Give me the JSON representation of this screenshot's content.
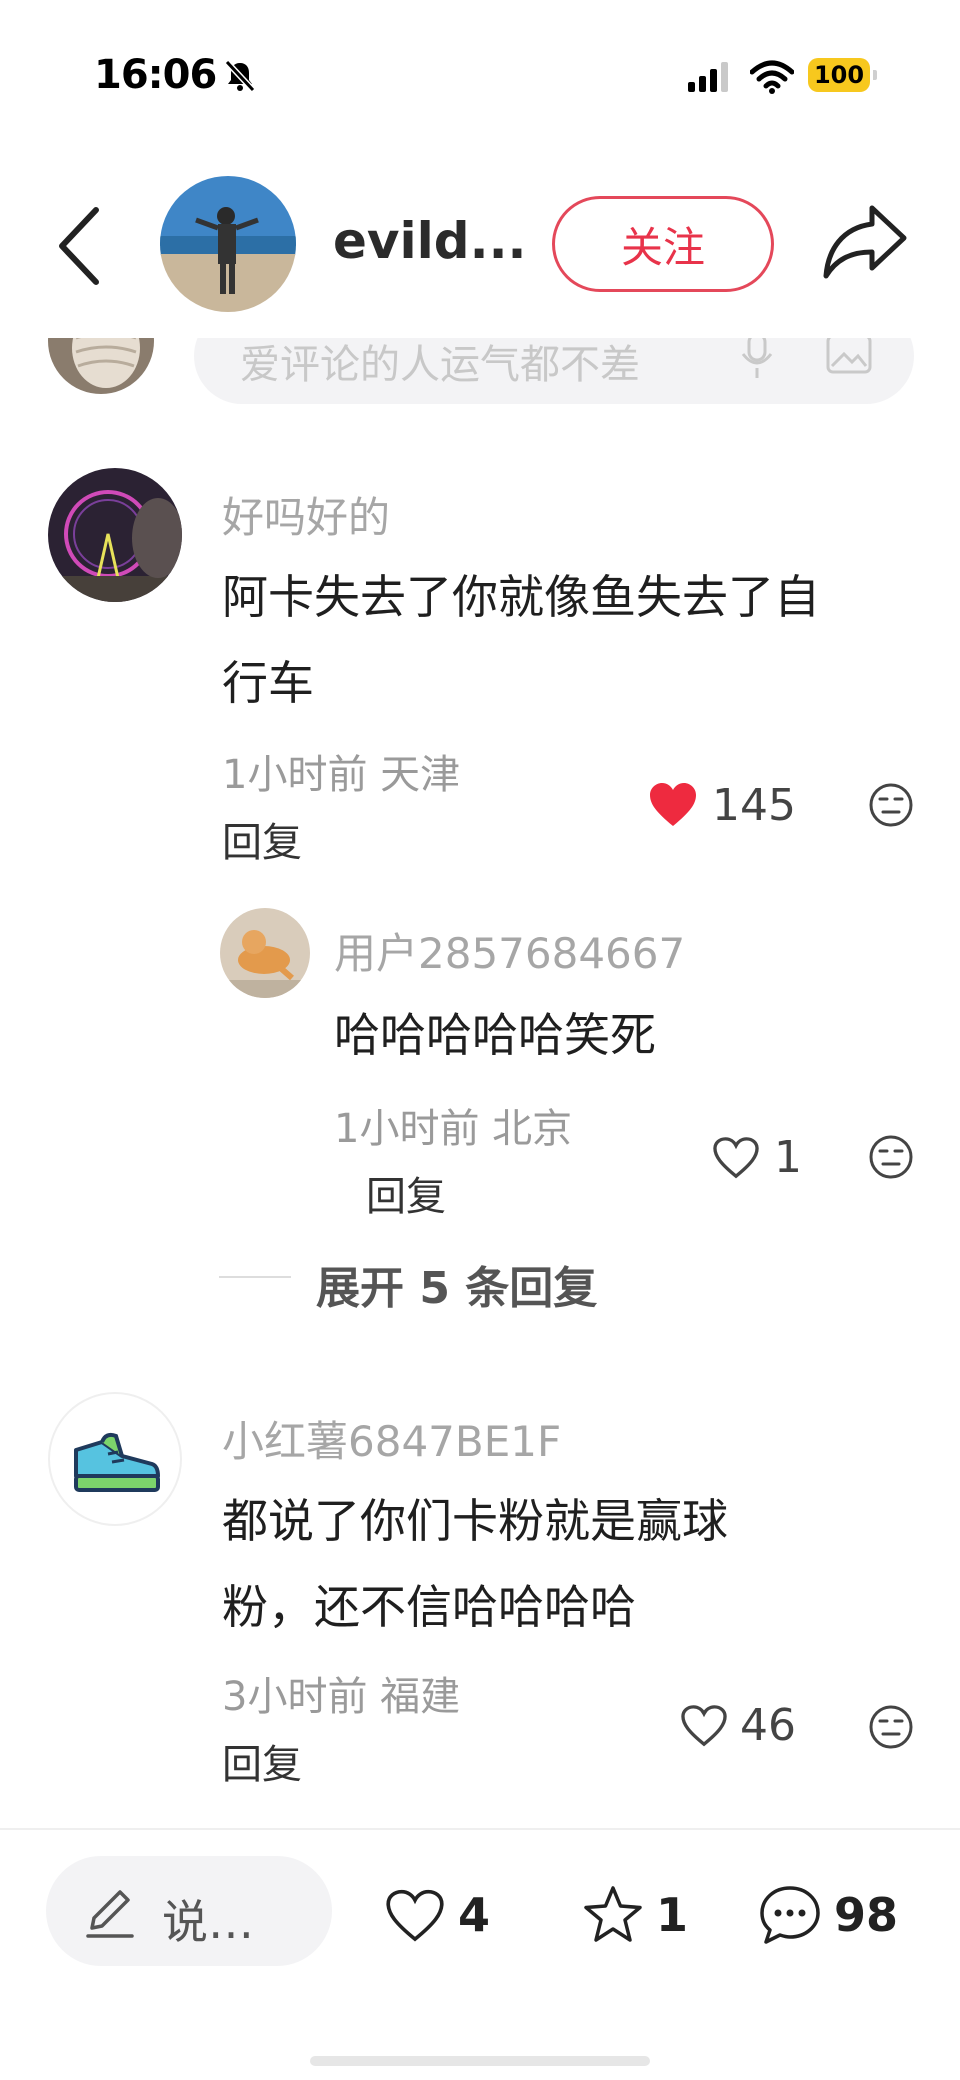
{
  "status_bar": {
    "time": "16:06",
    "battery": "100"
  },
  "header": {
    "username": "evild...",
    "follow_label": "关注"
  },
  "comment_input": {
    "placeholder": "爱评论的人运气都不差"
  },
  "comments": [
    {
      "user": "好吗好的",
      "text_line1": "阿卡失去了你就像鱼失去了自",
      "text_line2": "行车",
      "meta": "1小时前 天津",
      "reply_label": "回复",
      "likes": "145",
      "liked": true,
      "replies": [
        {
          "user": "用户2857684667",
          "text": "哈哈哈哈哈笑死",
          "meta": "1小时前 北京",
          "reply_label": "回复",
          "likes": "1"
        }
      ],
      "expand_label": "展开 5 条回复"
    },
    {
      "user": "小红薯6847BE1F",
      "text_line1": "都说了你们卡粉就是赢球",
      "text_line2": "粉，还不信哈哈哈哈",
      "meta": "3小时前 福建",
      "reply_label": "回复",
      "likes": "46",
      "liked": false
    }
  ],
  "bottom_bar": {
    "say_placeholder": "说…",
    "likes": "4",
    "stars": "1",
    "comments": "98"
  },
  "colors": {
    "accent_red": "#e8334a",
    "liked_heart": "#ee2a3f"
  }
}
